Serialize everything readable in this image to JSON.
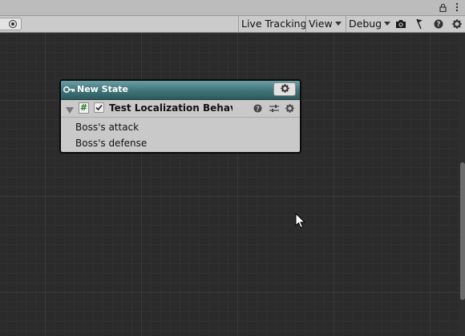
{
  "title_strip": {
    "icons": [
      "lock-icon",
      "more-options-icon"
    ]
  },
  "toolbar": {
    "live_tracking_label": "Live Tracking",
    "view_label": "View",
    "debug_label": "Debug",
    "icons": [
      "camera-icon",
      "flag-icon",
      "help-icon",
      "settings-icon"
    ]
  },
  "node": {
    "title": "New State",
    "behaviour": {
      "name": "Test Localization Behaviour",
      "enabled": true,
      "fields": [
        "Boss's attack",
        "Boss's defense"
      ]
    }
  },
  "colors": {
    "canvas_bg": "#2b2b2b",
    "node_header": "#3f7377",
    "script_icon_green": "#1d7a1d"
  }
}
